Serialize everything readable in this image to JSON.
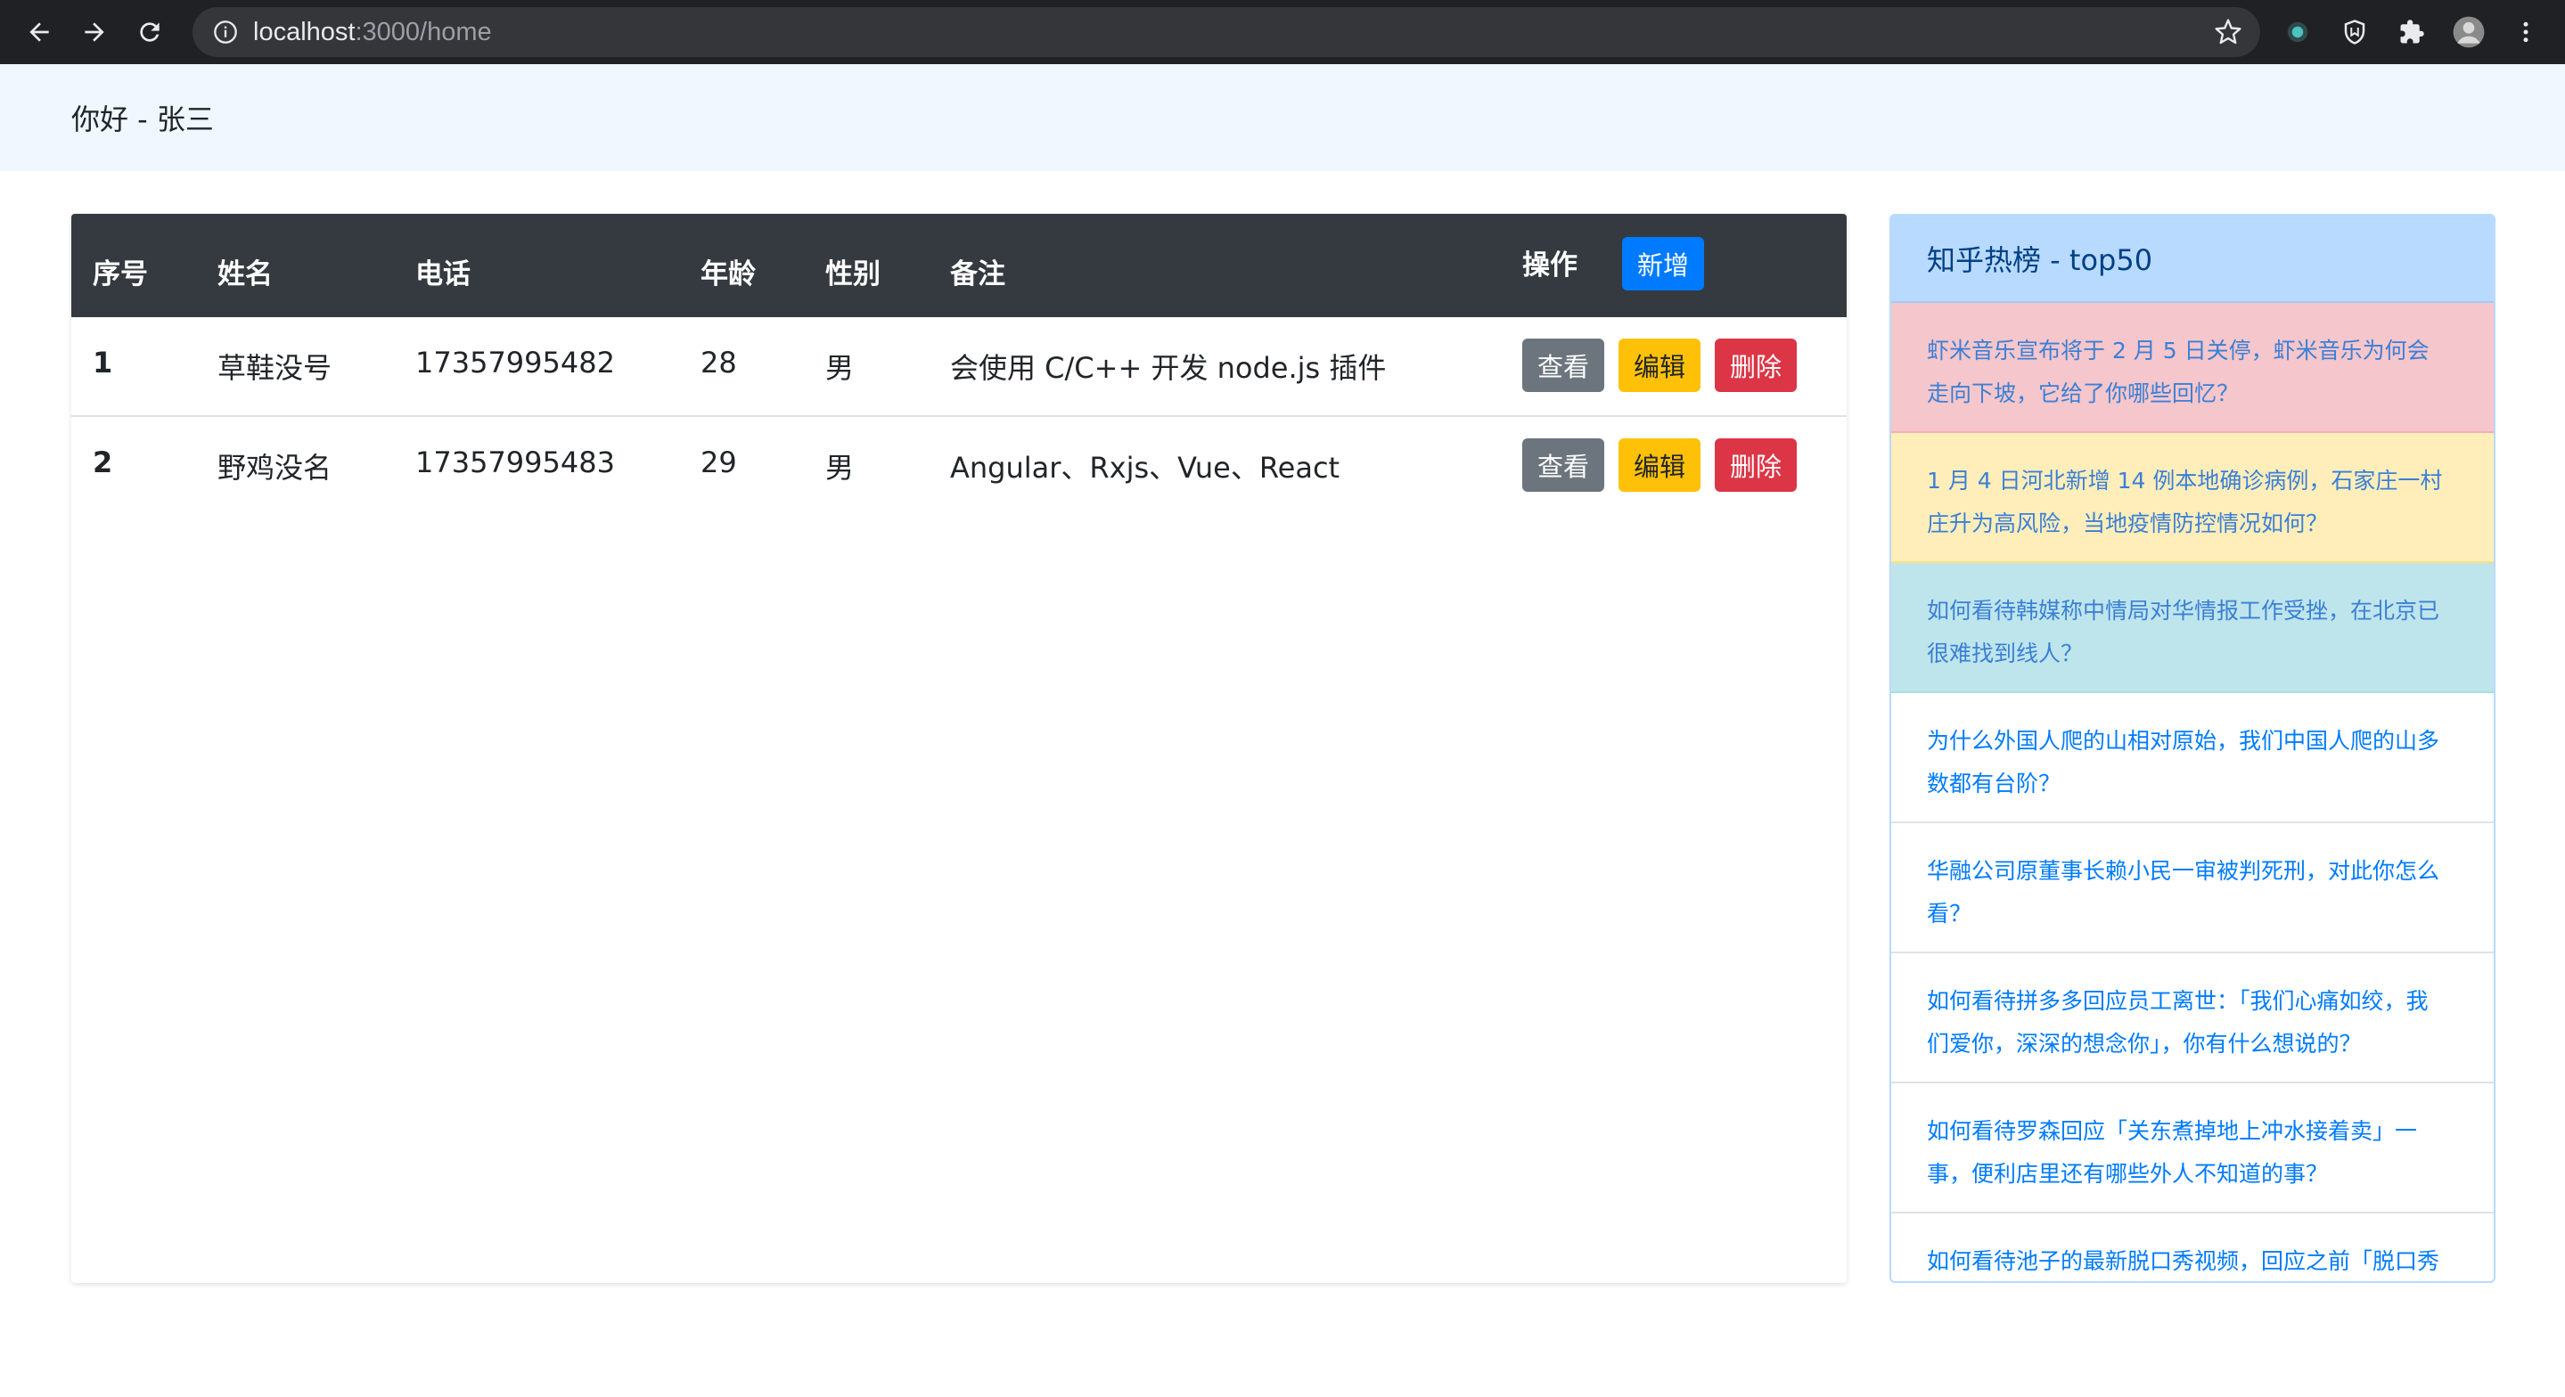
{
  "browser": {
    "url_host": "localhost",
    "url_path": ":3000/home"
  },
  "header": {
    "greeting": "你好 - 张三"
  },
  "table": {
    "columns": [
      "序号",
      "姓名",
      "电话",
      "年龄",
      "性别",
      "备注",
      "操作"
    ],
    "add_label": "新增",
    "rows": [
      {
        "index": "1",
        "name": "草鞋没号",
        "phone": "17357995482",
        "age": "28",
        "gender": "男",
        "note": "会使用 C/C++ 开发 node.js 插件"
      },
      {
        "index": "2",
        "name": "野鸡没名",
        "phone": "17357995483",
        "age": "29",
        "gender": "男",
        "note": "Angular、Rxjs、Vue、React"
      }
    ],
    "actions": {
      "view": "查看",
      "edit": "编辑",
      "delete": "删除"
    }
  },
  "hot": {
    "title": "知乎热榜 - top50",
    "items": [
      {
        "text": "虾米音乐宣布将于 2 月 5 日关停，虾米音乐为何会走向下坡，它给了你哪些回忆？",
        "style": "danger"
      },
      {
        "text": "1 月 4 日河北新增 14 例本地确诊病例，石家庄一村庄升为高风险，当地疫情防控情况如何？",
        "style": "warning"
      },
      {
        "text": "如何看待韩媒称中情局对华情报工作受挫，在北京已很难找到线人？",
        "style": "info"
      },
      {
        "text": "为什么外国人爬的山相对原始，我们中国人爬的山多数都有台阶？",
        "style": "plain"
      },
      {
        "text": "华融公司原董事长赖小民一审被判死刑，对此你怎么看？",
        "style": "plain"
      },
      {
        "text": "如何看待拼多多回应员工离世：「我们心痛如绞，我们爱你，深深的想念你」，你有什么想说的？",
        "style": "plain"
      },
      {
        "text": "如何看待罗森回应「关东煮掉地上冲水接着卖」一事，便利店里还有哪些外人不知道的事？",
        "style": "plain"
      },
      {
        "text": "如何看待池子的最新脱口秀视频，回应之前「脱口秀不",
        "style": "plain"
      }
    ]
  }
}
